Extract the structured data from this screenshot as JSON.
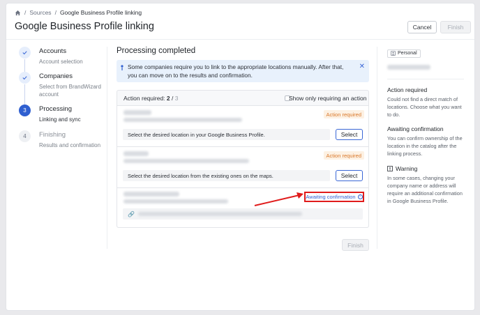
{
  "breadcrumb": {
    "sources": "Sources",
    "current": "Google Business Profile linking"
  },
  "header": {
    "title": "Google Business Profile linking",
    "cancel_label": "Cancel",
    "finish_label": "Finish"
  },
  "steps": [
    {
      "number": "1",
      "title": "Accounts",
      "subtitle": "Account selection",
      "state": "done"
    },
    {
      "number": "2",
      "title": "Companies",
      "subtitle": "Select from BrandWizard account",
      "state": "done"
    },
    {
      "number": "3",
      "title": "Processing",
      "subtitle": "Linking and sync",
      "state": "active"
    },
    {
      "number": "4",
      "title": "Finishing",
      "subtitle": "Results and confirmation",
      "state": "todo"
    }
  ],
  "main": {
    "heading": "Processing completed",
    "info_text": "Some companies require you to link to the appropriate locations manually. After that, you can move on to the results and confirmation.",
    "action_required_label": "Action required:",
    "action_required_done": "2",
    "action_required_sep": "/",
    "action_required_total": "3",
    "filter_label": "Show only requiring an action",
    "rows": [
      {
        "badge": "Action required",
        "instruction": "Select the desired location in your Google Business Profile.",
        "button": "Select"
      },
      {
        "badge": "Action required",
        "instruction": "Select the desired location from the existing ones on the maps.",
        "button": "Select"
      },
      {
        "badge": "Awaiting confirmation"
      }
    ],
    "finish_label": "Finish"
  },
  "sidebar_right": {
    "badge": "Personal",
    "sections": [
      {
        "title": "Action required",
        "text": "Could not find a direct match of locations. Choose what you want to do."
      },
      {
        "title": "Awaiting confirmation",
        "text": "You can confirm ownership of the location in the catalog after the linking process."
      },
      {
        "title": "Warning",
        "text": "In some cases, changing your company name or address will require an additional confirmation in Google Business Profile."
      }
    ]
  },
  "colors": {
    "primary": "#2f5fd0",
    "warning": "#d9782b",
    "highlight": "#e01b1b",
    "info_bg": "#e8f1fc"
  }
}
